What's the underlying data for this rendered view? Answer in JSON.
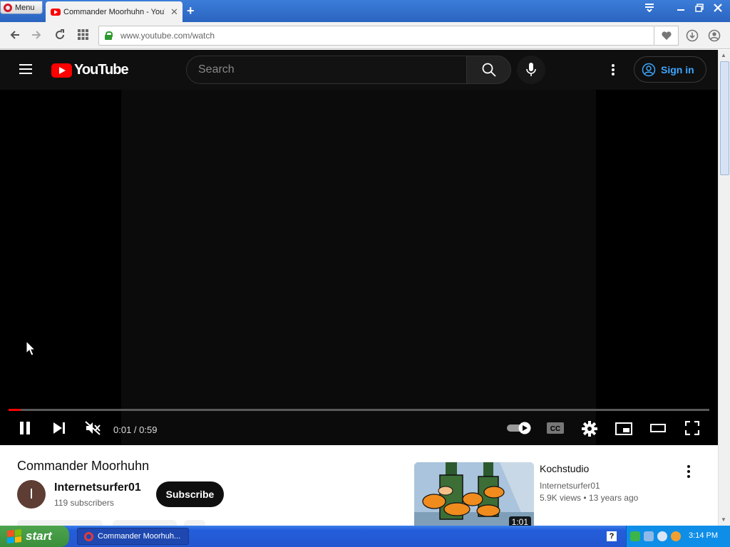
{
  "browser": {
    "menu_label": "Menu",
    "tab_title": "Commander Moorhuhn - YouTube",
    "url": "www.youtube.com/watch"
  },
  "youtube": {
    "logo_text": "YouTube",
    "search_placeholder": "Search",
    "sign_in_label": "Sign in"
  },
  "player": {
    "time_current": "0:01",
    "time_total": "0:59",
    "time_display": "0:01 / 0:59",
    "progress": 0.017
  },
  "video": {
    "title": "Commander Moorhuhn",
    "channel_initial": "I",
    "channel_name": "Internetsurfer01",
    "subscribers": "119 subscribers",
    "subscribe_label": "Subscribe"
  },
  "recommended": [
    {
      "title": "Kochstudio",
      "channel": "Internetsurfer01",
      "views": "5.9K views",
      "age": "13 years ago",
      "duration": "1:01"
    }
  ],
  "taskbar": {
    "start_label": "start",
    "task_label": "Commander Moorhuh...",
    "clock": "3:14 PM"
  },
  "colors": {
    "yt_red": "#ff0000",
    "yt_dark": "#0f0f0f",
    "signin_blue": "#3ea6ff",
    "xp_blue": "#245edb",
    "xp_start_green": "#3a8f3a"
  }
}
